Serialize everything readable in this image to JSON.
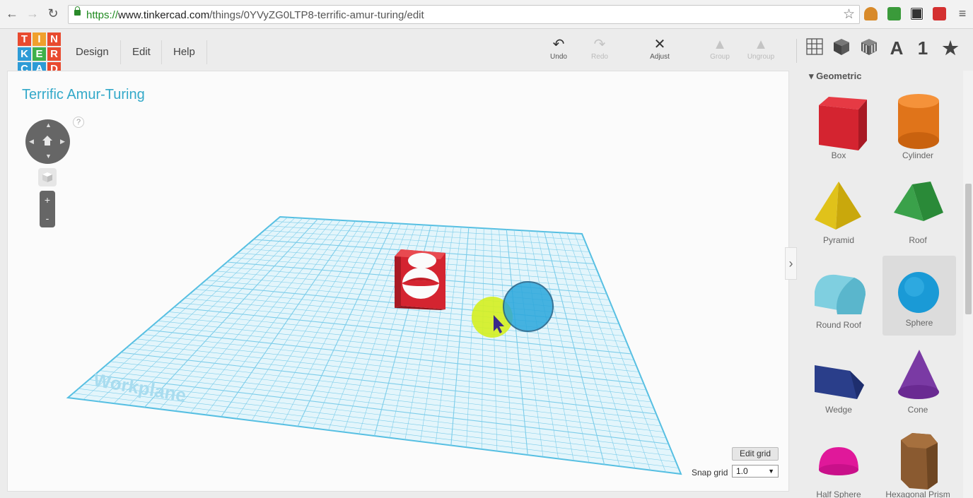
{
  "browser": {
    "url_scheme": "https://",
    "url_host": "www.tinkercad.com",
    "url_path": "/things/0YVyZG0LTP8-terrific-amur-turing/edit"
  },
  "logo": [
    "T",
    "I",
    "N",
    "K",
    "E",
    "R",
    "C",
    "A",
    "D"
  ],
  "logo_colors": [
    "#e84a2f",
    "#f0a02c",
    "#e84a2f",
    "#2d9bd6",
    "#3fb04a",
    "#e84a2f",
    "#2d9bd6",
    "#2d9bd6",
    "#e84a2f"
  ],
  "menu": {
    "design": "Design",
    "edit": "Edit",
    "help": "Help"
  },
  "toolbar": {
    "undo": "Undo",
    "redo": "Redo",
    "adjust": "Adjust",
    "group": "Group",
    "ungroup": "Ungroup"
  },
  "view_buttons": {
    "text": "A",
    "number": "1"
  },
  "design": {
    "title": "Terrific Amur-Turing",
    "help": "?",
    "workplane_label": "Workplane"
  },
  "zoom": {
    "plus": "+",
    "minus": "-"
  },
  "grid": {
    "edit_button": "Edit grid",
    "snap_label": "Snap grid",
    "snap_value": "1.0"
  },
  "panel": {
    "category": "Geometric",
    "shapes": [
      {
        "label": "Box",
        "icon": "box-icon"
      },
      {
        "label": "Cylinder",
        "icon": "cylinder-icon"
      },
      {
        "label": "Pyramid",
        "icon": "pyramid-icon"
      },
      {
        "label": "Roof",
        "icon": "roof-icon"
      },
      {
        "label": "Round Roof",
        "icon": "round-roof-icon"
      },
      {
        "label": "Sphere",
        "icon": "sphere-icon",
        "selected": true
      },
      {
        "label": "Wedge",
        "icon": "wedge-icon"
      },
      {
        "label": "Cone",
        "icon": "cone-icon"
      },
      {
        "label": "Half Sphere",
        "icon": "half-sphere-icon"
      },
      {
        "label": "Hexagonal Prism",
        "icon": "hexagonal-prism-icon"
      }
    ]
  },
  "colors": {
    "accent": "#33a9c9",
    "workplane": "#6cc9e8",
    "box": "#d42430",
    "sphere": "#2aa7dc"
  }
}
